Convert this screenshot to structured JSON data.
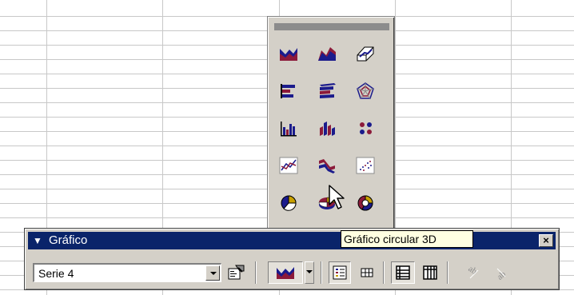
{
  "toolbar": {
    "title": "Gráfico",
    "series_selector": {
      "value": "Serie 4"
    },
    "buttons": [
      {
        "name": "format-object-button",
        "icon": "format-object-icon"
      },
      {
        "name": "chart-type-button",
        "icon": "area-chart-icon"
      },
      {
        "name": "legend-button",
        "icon": "legend-icon"
      },
      {
        "name": "data-table-button",
        "icon": "data-table-icon"
      },
      {
        "name": "by-row-button",
        "icon": "by-row-icon"
      },
      {
        "name": "by-column-button",
        "icon": "by-column-icon"
      },
      {
        "name": "angle-text-downward-button",
        "icon": "angle-text-downward-icon"
      },
      {
        "name": "angle-text-upward-button",
        "icon": "angle-text-upward-icon"
      }
    ]
  },
  "chart_palette": {
    "hovered": "pie-3d-icon",
    "items": [
      "area-chart-icon",
      "area-3d-chart-icon",
      "surface-3d-chart-icon",
      "bar-chart-icon",
      "bar-3d-chart-icon",
      "radar-chart-icon",
      "column-chart-icon",
      "column-3d-chart-icon",
      "scatter-dots-icon",
      "line-chart-icon",
      "line-3d-chart-icon",
      "xy-scatter-chart-icon",
      "pie-chart-icon",
      "pie-3d-chart-icon",
      "doughnut-chart-icon",
      "cylinder-chart-icon",
      "cone-chart-icon",
      "pyramid-chart-icon"
    ]
  },
  "tooltip": {
    "text": "Gráfico circular 3D"
  },
  "colors": {
    "navy": "#1b1b8c",
    "maroon": "#8c1a3a",
    "titlebar": "#0a246a",
    "face": "#d4d0c8"
  }
}
